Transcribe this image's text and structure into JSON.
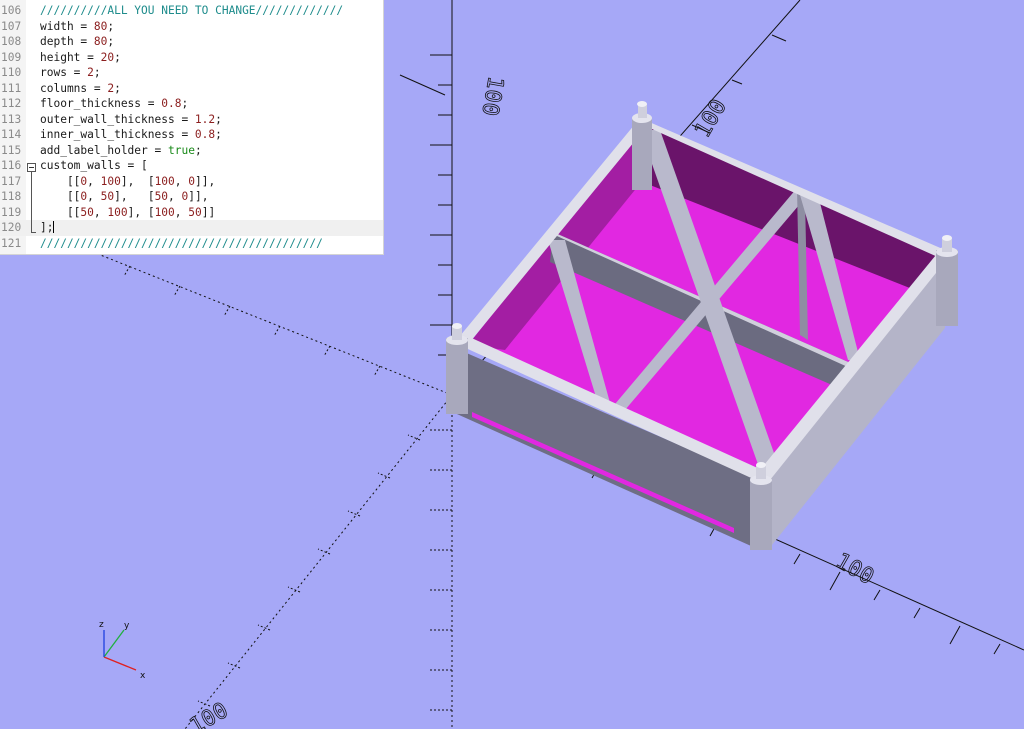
{
  "editor": {
    "lines": [
      {
        "no": "106",
        "parts": [
          {
            "t": "//////////ALL YOU NEED TO CHANGE/////////////",
            "c": "comment"
          }
        ]
      },
      {
        "no": "107",
        "parts": [
          {
            "t": "width = ",
            "c": "plain"
          },
          {
            "t": "80",
            "c": "num"
          },
          {
            "t": ";",
            "c": "plain"
          }
        ]
      },
      {
        "no": "108",
        "parts": [
          {
            "t": "depth = ",
            "c": "plain"
          },
          {
            "t": "80",
            "c": "num"
          },
          {
            "t": ";",
            "c": "plain"
          }
        ]
      },
      {
        "no": "109",
        "parts": [
          {
            "t": "height = ",
            "c": "plain"
          },
          {
            "t": "20",
            "c": "num"
          },
          {
            "t": ";",
            "c": "plain"
          }
        ]
      },
      {
        "no": "110",
        "parts": [
          {
            "t": "rows = ",
            "c": "plain"
          },
          {
            "t": "2",
            "c": "num"
          },
          {
            "t": ";",
            "c": "plain"
          }
        ]
      },
      {
        "no": "111",
        "parts": [
          {
            "t": "columns = ",
            "c": "plain"
          },
          {
            "t": "2",
            "c": "num"
          },
          {
            "t": ";",
            "c": "plain"
          }
        ]
      },
      {
        "no": "112",
        "parts": [
          {
            "t": "floor_thickness = ",
            "c": "plain"
          },
          {
            "t": "0.8",
            "c": "num"
          },
          {
            "t": ";",
            "c": "plain"
          }
        ]
      },
      {
        "no": "113",
        "parts": [
          {
            "t": "outer_wall_thickness = ",
            "c": "plain"
          },
          {
            "t": "1.2",
            "c": "num"
          },
          {
            "t": ";",
            "c": "plain"
          }
        ]
      },
      {
        "no": "114",
        "parts": [
          {
            "t": "inner_wall_thickness = ",
            "c": "plain"
          },
          {
            "t": "0.8",
            "c": "num"
          },
          {
            "t": ";",
            "c": "plain"
          }
        ]
      },
      {
        "no": "115",
        "parts": [
          {
            "t": "add_label_holder = ",
            "c": "plain"
          },
          {
            "t": "true",
            "c": "bool"
          },
          {
            "t": ";",
            "c": "plain"
          }
        ]
      },
      {
        "no": "116",
        "parts": [
          {
            "t": "custom_walls = [",
            "c": "plain"
          }
        ]
      },
      {
        "no": "117",
        "parts": [
          {
            "t": "    [[",
            "c": "plain"
          },
          {
            "t": "0",
            "c": "num"
          },
          {
            "t": ", ",
            "c": "plain"
          },
          {
            "t": "100",
            "c": "num"
          },
          {
            "t": "],  [",
            "c": "plain"
          },
          {
            "t": "100",
            "c": "num"
          },
          {
            "t": ", ",
            "c": "plain"
          },
          {
            "t": "0",
            "c": "num"
          },
          {
            "t": "]],",
            "c": "plain"
          }
        ]
      },
      {
        "no": "118",
        "parts": [
          {
            "t": "    [[",
            "c": "plain"
          },
          {
            "t": "0",
            "c": "num"
          },
          {
            "t": ", ",
            "c": "plain"
          },
          {
            "t": "50",
            "c": "num"
          },
          {
            "t": "],   [",
            "c": "plain"
          },
          {
            "t": "50",
            "c": "num"
          },
          {
            "t": ", ",
            "c": "plain"
          },
          {
            "t": "0",
            "c": "num"
          },
          {
            "t": "]],",
            "c": "plain"
          }
        ]
      },
      {
        "no": "119",
        "parts": [
          {
            "t": "    [[",
            "c": "plain"
          },
          {
            "t": "50",
            "c": "num"
          },
          {
            "t": ", ",
            "c": "plain"
          },
          {
            "t": "100",
            "c": "num"
          },
          {
            "t": "], [",
            "c": "plain"
          },
          {
            "t": "100",
            "c": "num"
          },
          {
            "t": ", ",
            "c": "plain"
          },
          {
            "t": "50",
            "c": "num"
          },
          {
            "t": "]]",
            "c": "plain"
          }
        ]
      },
      {
        "no": "120",
        "parts": [
          {
            "t": "];",
            "c": "plain"
          }
        ]
      },
      {
        "no": "121",
        "parts": [
          {
            "t": "//////////////////////////////////////////",
            "c": "comment"
          }
        ]
      }
    ],
    "current_line": "120"
  },
  "viewport": {
    "axis_labels": {
      "a": "100",
      "b": "100",
      "c": "100",
      "d": "100"
    },
    "gizmo": {
      "x": "x",
      "y": "y",
      "z": "z"
    },
    "colors": {
      "background": "#a6a8f7",
      "floor": "#e128e1",
      "wall": "#7a7a8e",
      "wall_light": "#b9b9cc",
      "wall_dark": "#6b6b80",
      "inner_purple": "#a31ea3"
    }
  }
}
